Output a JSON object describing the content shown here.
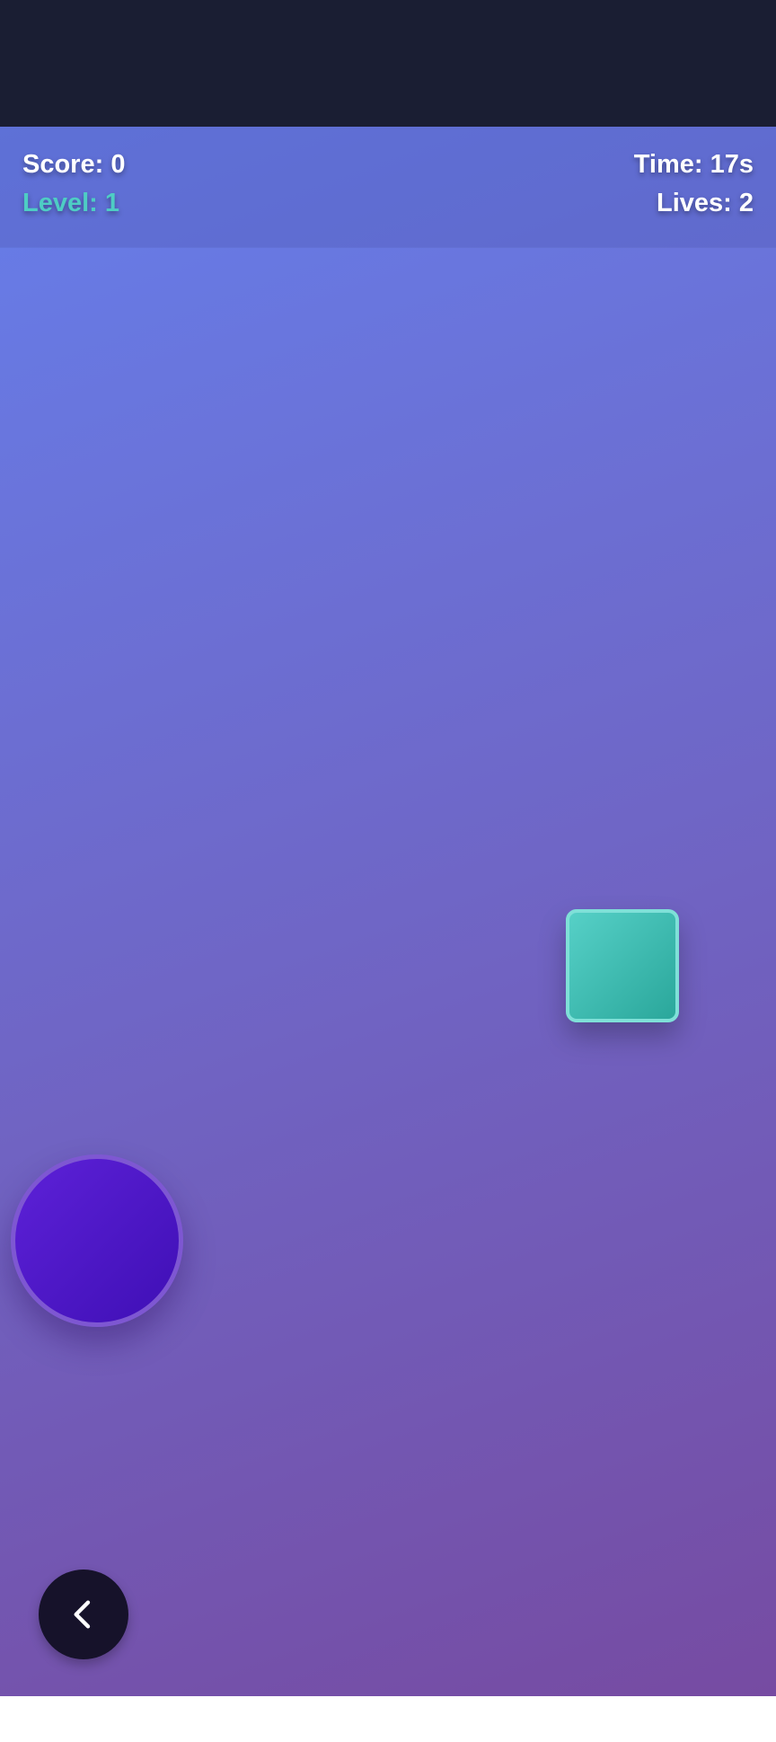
{
  "hud": {
    "score": "Score: 0",
    "level": "Level: 1",
    "time": "Time: 17s",
    "lives": "Lives: 2"
  },
  "colors": {
    "status_bar": "#1a1e33",
    "background_gradient_start": "#667eea",
    "background_gradient_end": "#764ba2",
    "level_text": "#4ecdc4",
    "target": "#4ecdc4",
    "player": "#4a14c8",
    "back_button": "#16122a"
  },
  "icons": {
    "back": "chevron-left-icon"
  }
}
